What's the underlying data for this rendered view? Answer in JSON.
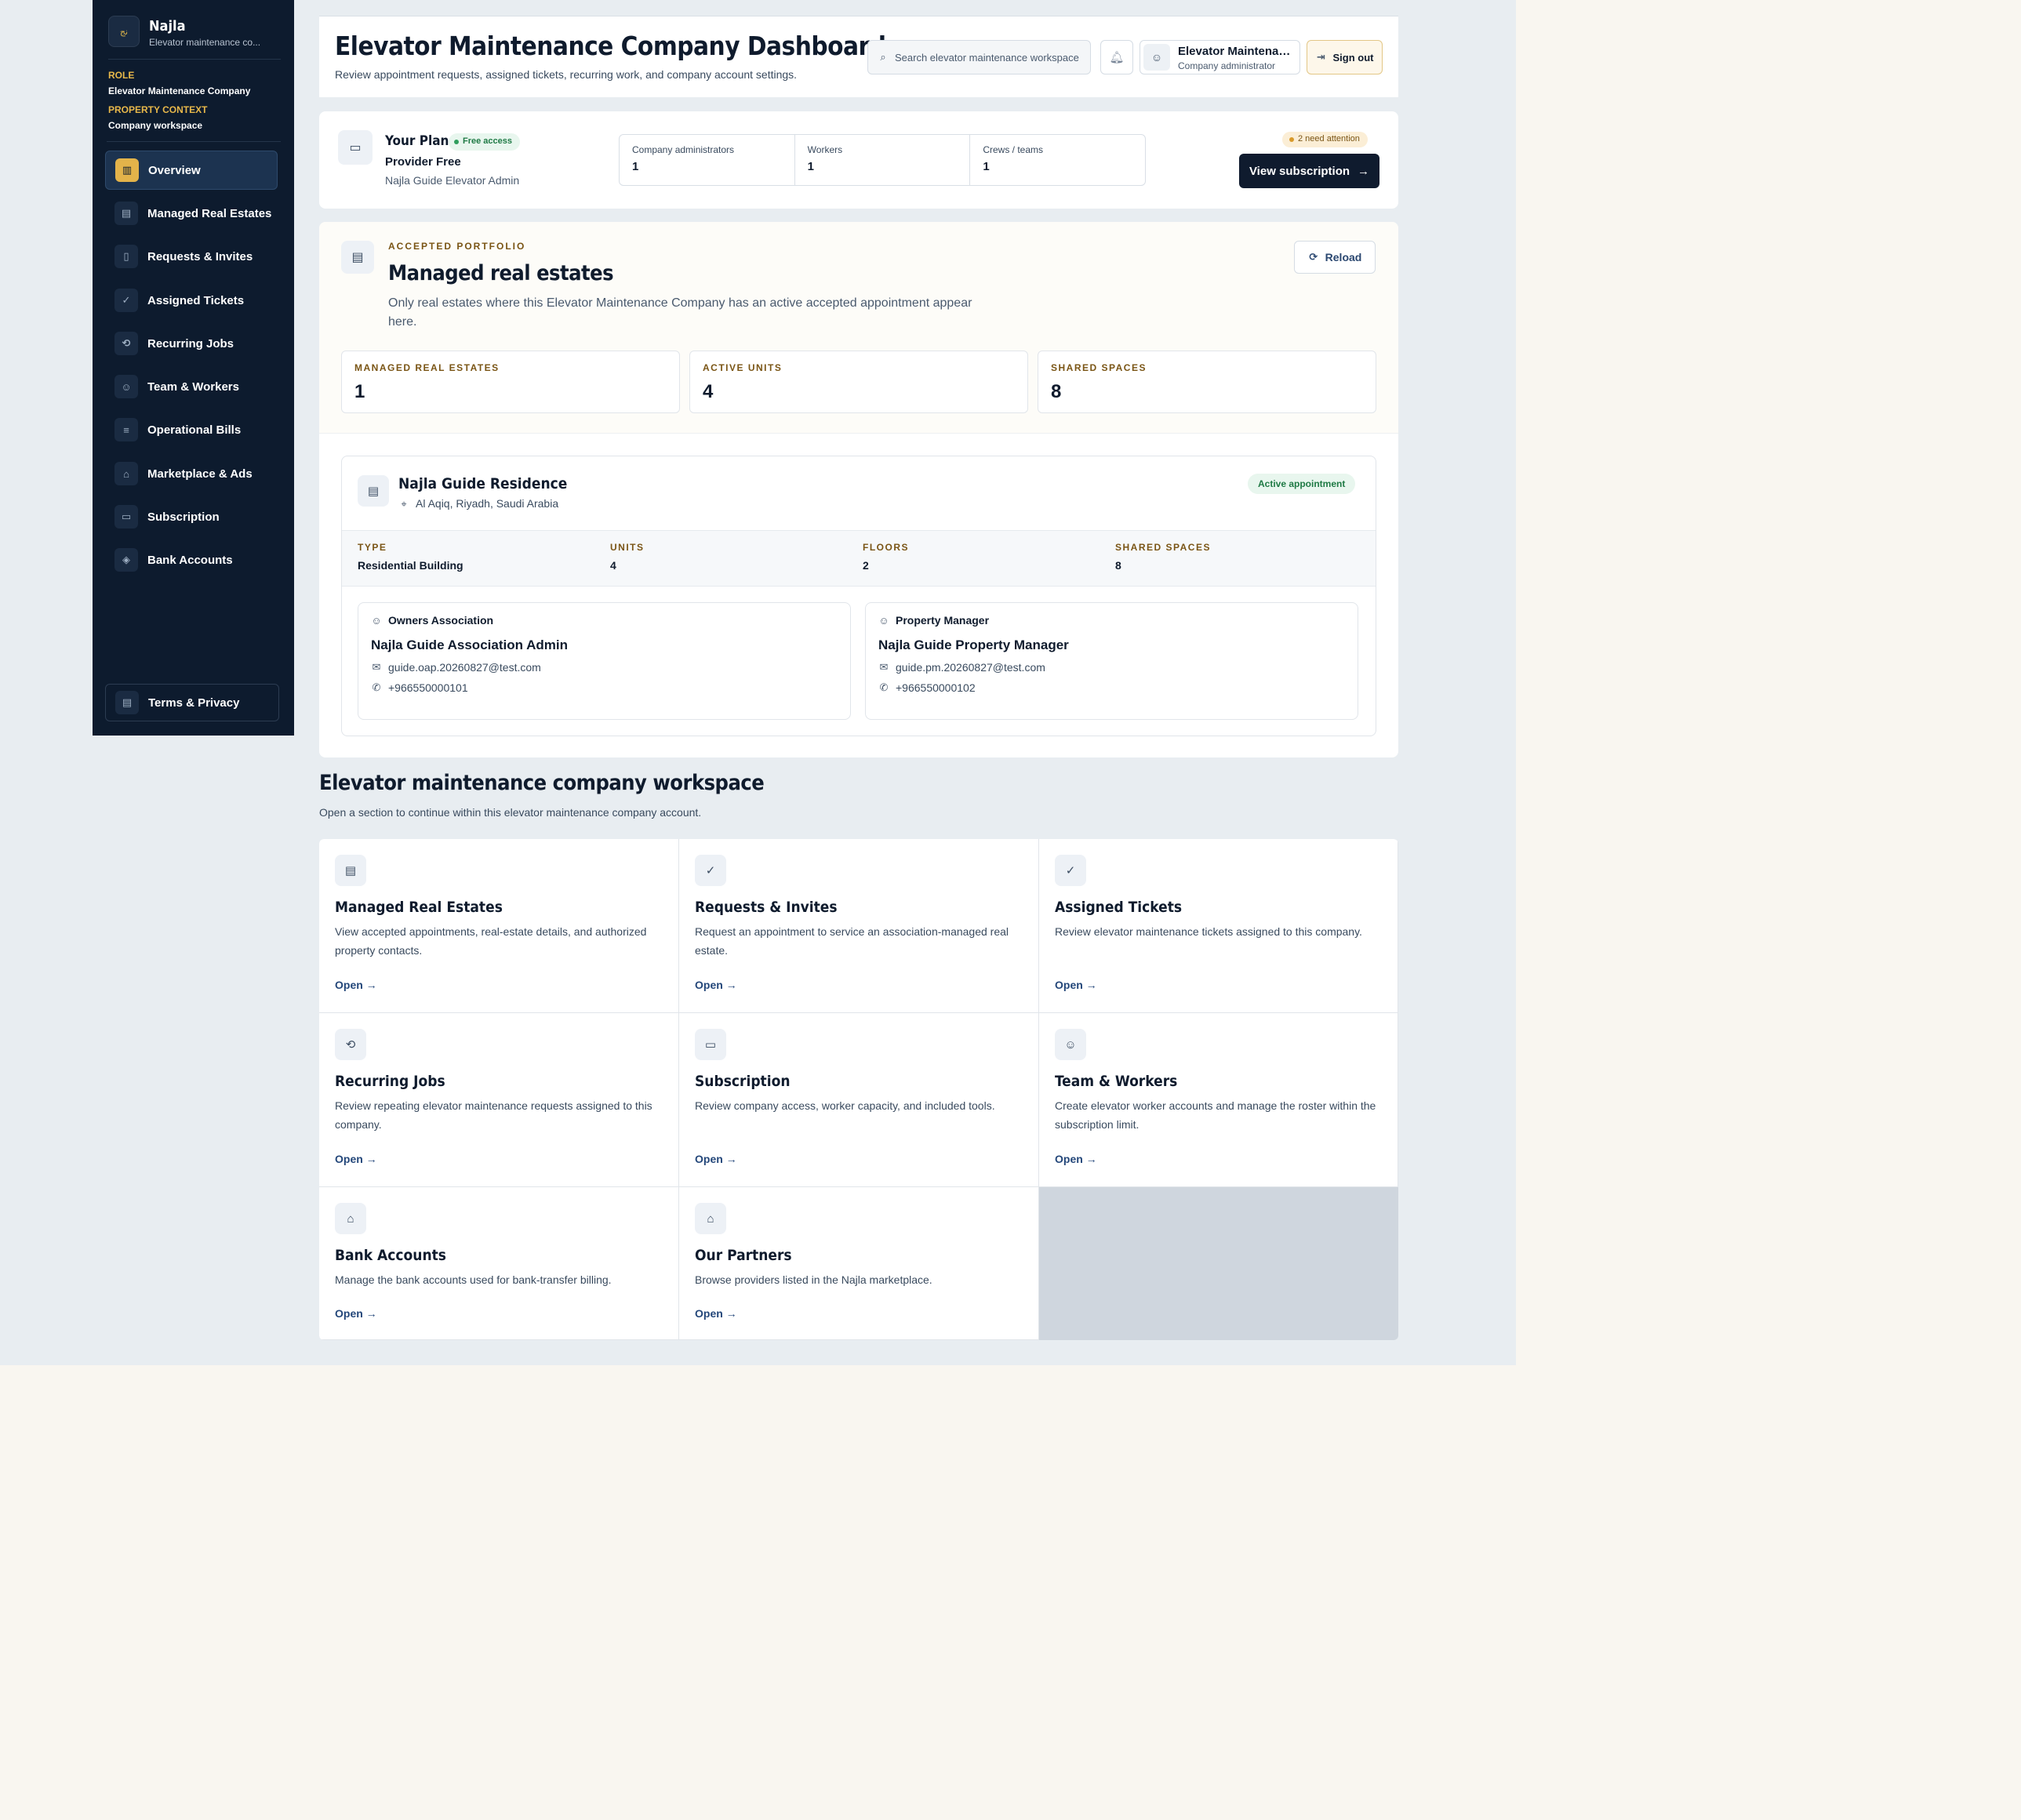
{
  "sidebar": {
    "brand_mark": "نج",
    "brand_name": "Najla",
    "brand_sub": "Elevator maintenance co...",
    "role_label": "ROLE",
    "role_value": "Elevator Maintenance Company",
    "context_label": "PROPERTY CONTEXT",
    "context_value": "Company workspace",
    "items": [
      {
        "label": "Overview",
        "icon": "chart-icon",
        "active": true
      },
      {
        "label": "Managed Real Estates",
        "icon": "building-icon"
      },
      {
        "label": "Requests & Invites",
        "icon": "clipboard-icon"
      },
      {
        "label": "Assigned Tickets",
        "icon": "clipboard-check-icon"
      },
      {
        "label": "Recurring Jobs",
        "icon": "repeat-icon"
      },
      {
        "label": "Team & Workers",
        "icon": "users-icon"
      },
      {
        "label": "Operational Bills",
        "icon": "receipt-icon"
      },
      {
        "label": "Marketplace & Ads",
        "icon": "store-icon"
      },
      {
        "label": "Subscription",
        "icon": "card-icon"
      },
      {
        "label": "Bank Accounts",
        "icon": "shield-icon"
      }
    ],
    "terms": "Terms & Privacy"
  },
  "header": {
    "title": "Elevator Maintenance Company Dashboard",
    "subtitle": "Review appointment requests, assigned tickets, recurring work, and company account settings.",
    "search_placeholder": "Search elevator maintenance workspace",
    "user_name": "Elevator Maintenan...",
    "user_role": "Company administrator",
    "signout": "Sign out"
  },
  "plan": {
    "title": "Your Plan",
    "badge": "Free access",
    "name": "Provider Free",
    "admin": "Najla Guide Elevator Admin",
    "stats": [
      {
        "label": "Company administrators",
        "value": "1"
      },
      {
        "label": "Workers",
        "value": "1"
      },
      {
        "label": "Crews / teams",
        "value": "1"
      }
    ],
    "attention": "2 need attention",
    "view_button": "View subscription"
  },
  "portfolio": {
    "eyebrow": "ACCEPTED PORTFOLIO",
    "title": "Managed real estates",
    "description": "Only real estates where this Elevator Maintenance Company has an active accepted appointment appear here.",
    "reload": "Reload",
    "kpis": [
      {
        "label": "MANAGED REAL ESTATES",
        "value": "1"
      },
      {
        "label": "ACTIVE UNITS",
        "value": "4"
      },
      {
        "label": "SHARED SPACES",
        "value": "8"
      }
    ],
    "residence": {
      "name": "Najla Guide Residence",
      "location": "Al Aqiq, Riyadh, Saudi Arabia",
      "status": "Active appointment",
      "facts": [
        {
          "label": "TYPE",
          "value": "Residential Building"
        },
        {
          "label": "UNITS",
          "value": "4"
        },
        {
          "label": "FLOORS",
          "value": "2"
        },
        {
          "label": "SHARED SPACES",
          "value": "8"
        }
      ],
      "contacts": [
        {
          "role": "Owners Association",
          "name": "Najla Guide Association Admin",
          "email": "guide.oap.20260827@test.com",
          "phone": "+966550000101"
        },
        {
          "role": "Property Manager",
          "name": "Najla Guide Property Manager",
          "email": "guide.pm.20260827@test.com",
          "phone": "+966550000102"
        }
      ]
    }
  },
  "workspace": {
    "title": "Elevator maintenance company workspace",
    "subtitle": "Open a section to continue within this elevator maintenance company account.",
    "open_label": "Open",
    "cards": [
      {
        "title": "Managed Real Estates",
        "desc": "View accepted appointments, real-estate details, and authorized property contacts.",
        "icon": "building-icon"
      },
      {
        "title": "Requests & Invites",
        "desc": "Request an appointment to service an association-managed real estate.",
        "icon": "clipboard-icon"
      },
      {
        "title": "Assigned Tickets",
        "desc": "Review elevator maintenance tickets assigned to this company.",
        "icon": "clipboard-check-icon"
      },
      {
        "title": "Recurring Jobs",
        "desc": "Review repeating elevator maintenance requests assigned to this company.",
        "icon": "repeat-icon"
      },
      {
        "title": "Subscription",
        "desc": "Review company access, worker capacity, and included tools.",
        "icon": "card-icon"
      },
      {
        "title": "Team & Workers",
        "desc": "Create elevator worker accounts and manage the roster within the subscription limit.",
        "icon": "users-icon"
      },
      {
        "title": "Bank Accounts",
        "desc": "Manage the bank accounts used for bank-transfer billing.",
        "icon": "bank-icon"
      },
      {
        "title": "Our Partners",
        "desc": "Browse providers listed in the Najla marketplace.",
        "icon": "store-icon"
      }
    ]
  }
}
